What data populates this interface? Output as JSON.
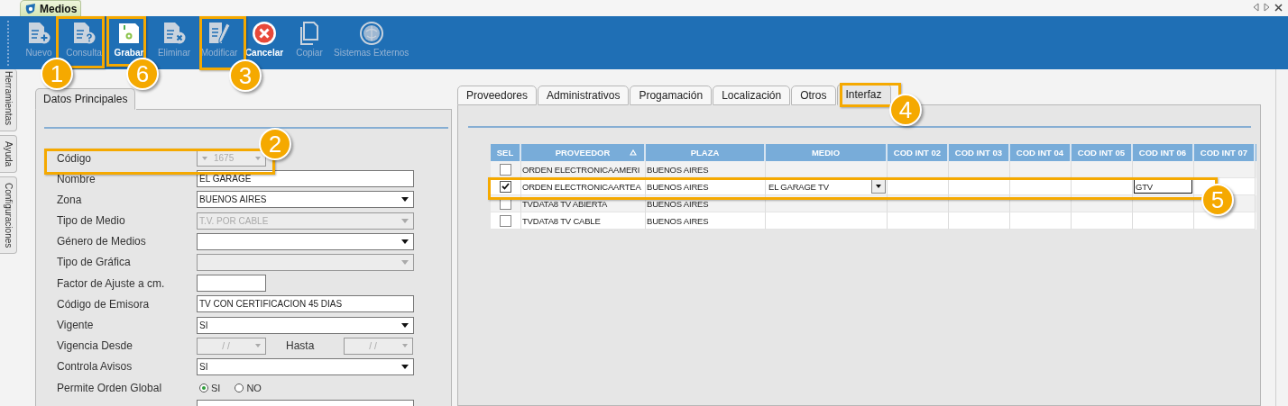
{
  "window_tab": {
    "title": "Medios"
  },
  "toolbar": [
    {
      "label": "Nuevo",
      "kind": "add",
      "disabled": true
    },
    {
      "label": "Consulta",
      "kind": "query",
      "disabled": true
    },
    {
      "label": "Grabar",
      "kind": "save",
      "disabled": false
    },
    {
      "label": "Eliminar",
      "kind": "delete",
      "disabled": true
    },
    {
      "label": "Modificar",
      "kind": "edit",
      "disabled": true
    },
    {
      "label": "Cancelar",
      "kind": "cancel",
      "disabled": false
    },
    {
      "label": "Copiar",
      "kind": "copy",
      "disabled": true
    },
    {
      "label": "Sistemas Externos",
      "kind": "external",
      "disabled": true
    }
  ],
  "side_tabs": [
    "Herramientas",
    "Ayuda",
    "Configuraciones"
  ],
  "left_panel": {
    "tab": "Datos Principales",
    "fields": [
      {
        "label": "Código",
        "kind": "code",
        "value": "1675",
        "disabled": true
      },
      {
        "label": "Nombre",
        "kind": "text",
        "value": "EL GARAGE",
        "disabled": false
      },
      {
        "label": "Zona",
        "kind": "combo",
        "value": "BUENOS AIRES",
        "disabled": false
      },
      {
        "label": "Tipo de Medio",
        "kind": "combo",
        "value": "T.V. POR CABLE",
        "disabled": true
      },
      {
        "label": "Género de Medios",
        "kind": "combo",
        "disabled": false
      },
      {
        "label": "Tipo de Gráfica",
        "kind": "combo",
        "disabled": true
      },
      {
        "label": "Factor de Ajuste a cm.",
        "kind": "short",
        "disabled": false
      },
      {
        "label": "Código de Emisora",
        "kind": "text",
        "value": "TV CON CERTIFICACION 45 DIAS",
        "disabled": false
      },
      {
        "label": "Vigente",
        "kind": "combo",
        "value": "SI",
        "disabled": false
      },
      {
        "label": "Vigencia Desde",
        "kind": "dates",
        "value": "/ /",
        "label2": "Hasta",
        "value2": "/ /",
        "disabled": true
      },
      {
        "label": "Controla Avisos",
        "kind": "combo",
        "value": "SI",
        "disabled": false
      },
      {
        "label": "Permite Orden Global",
        "kind": "radio",
        "options": [
          {
            "label": "SI",
            "selected": true
          },
          {
            "label": "NO",
            "selected": false
          }
        ]
      }
    ]
  },
  "right_panel": {
    "tabs": [
      {
        "label": "Proveedores",
        "selected": false
      },
      {
        "label": "Administrativos",
        "selected": false
      },
      {
        "label": "Progamación",
        "selected": false
      },
      {
        "label": "Localización",
        "selected": false
      },
      {
        "label": "Otros",
        "selected": false
      },
      {
        "label": "Interfaz",
        "selected": true
      }
    ],
    "grid": {
      "columns": [
        {
          "title": "SEL",
          "sorted": false
        },
        {
          "title": "PROVEEDOR",
          "sorted": true
        },
        {
          "title": "PLAZA",
          "sorted": false
        },
        {
          "title": "MEDIO",
          "sorted": false
        },
        {
          "title": "COD INT 02",
          "sorted": false
        },
        {
          "title": "COD INT 03",
          "sorted": false
        },
        {
          "title": "COD INT 04",
          "sorted": false
        },
        {
          "title": "COD INT 05",
          "sorted": false
        },
        {
          "title": "COD INT 06",
          "sorted": false
        },
        {
          "title": "COD INT 07",
          "sorted": false
        }
      ],
      "rows": [
        {
          "checked": false,
          "proveedor": "ORDEN ELECTRONICAAMERI",
          "plaza": "BUENOS AIRES"
        },
        {
          "checked": true,
          "proveedor": "ORDEN ELECTRONICAARTEA",
          "plaza": "BUENOS AIRES",
          "medio": {
            "kind": "dropdown",
            "value": "EL GARAGE TV"
          },
          "cod_int_06": {
            "kind": "input",
            "value": "GTV"
          }
        },
        {
          "checked": false,
          "proveedor": "TVDATA8 TV ABIERTA",
          "plaza": "BUENOS AIRES"
        },
        {
          "checked": false,
          "proveedor": "TVDATA8 TV CABLE",
          "plaza": "BUENOS AIRES"
        }
      ]
    }
  },
  "callouts": [
    {
      "number": "1"
    },
    {
      "number": "6"
    },
    {
      "number": "3"
    },
    {
      "number": "2"
    },
    {
      "number": "4"
    },
    {
      "number": "5"
    }
  ]
}
